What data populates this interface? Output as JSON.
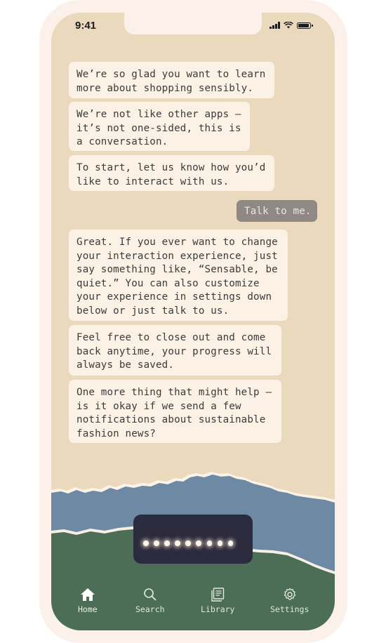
{
  "status_bar": {
    "time": "9:41"
  },
  "conversation": {
    "messages": [
      {
        "from": "app",
        "text": "We’re so glad you want to learn\nmore about shopping sensibly."
      },
      {
        "from": "app",
        "text": "We’re not like other apps —\nit’s not one-sided, this is\na conversation."
      },
      {
        "from": "app",
        "text": "To start, let us know how you’d\nlike to interact with us."
      },
      {
        "from": "user",
        "text": "Talk to me."
      },
      {
        "from": "app",
        "text": "Great. If you ever want to change\nyour interaction experience, just\nsay something like, “Sensable, be\nquiet.” You can also customize\nyour experience in settings down\nbelow or just talk to us."
      },
      {
        "from": "app",
        "text": "Feel free to close out and come\nback anytime, your progress will\nalways be saved."
      },
      {
        "from": "app",
        "text": "One more thing that might help —\nis it okay if we send a few\nnotifications about sustainable\nfashion news?"
      }
    ]
  },
  "nav": {
    "items": [
      {
        "label": "Home",
        "icon": "home-icon",
        "active": true
      },
      {
        "label": "Search",
        "icon": "search-icon",
        "active": false
      },
      {
        "label": "Library",
        "icon": "library-icon",
        "active": false
      },
      {
        "label": "Settings",
        "icon": "gear-icon",
        "active": false
      }
    ]
  },
  "colors": {
    "background_paper": "#ead9bd",
    "bubble": "#fbf1e4",
    "user_bubble": "#908884",
    "mountain_blue": "#6e89a3",
    "hill_green": "#4d6e56",
    "voice_pill": "#2c2a3d"
  }
}
